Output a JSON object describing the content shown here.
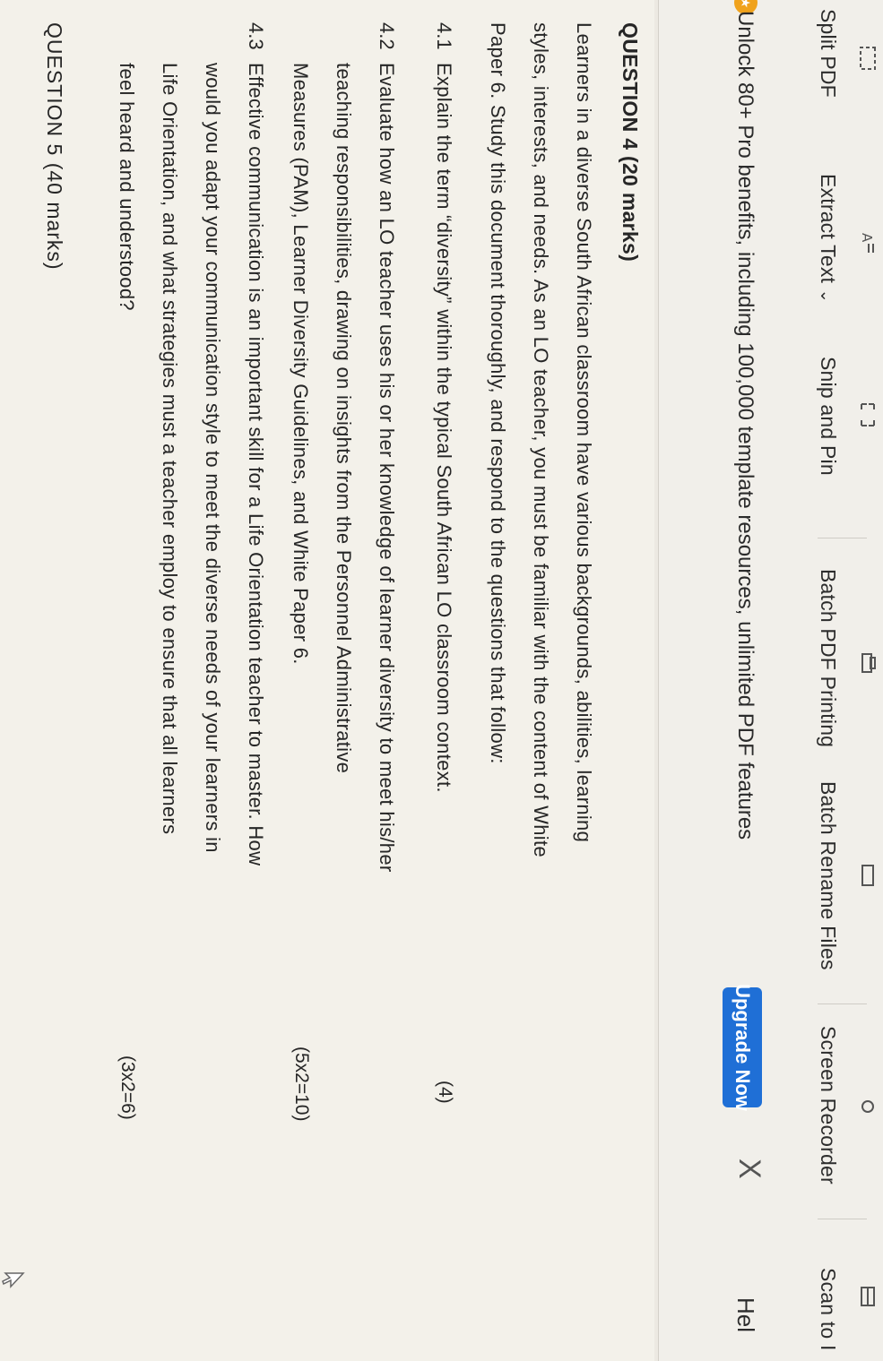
{
  "toolbar": {
    "items": [
      {
        "label": "Split PDF",
        "icon": "split-pdf-icon"
      },
      {
        "label": "Extract Text",
        "icon": "extract-text-icon"
      },
      {
        "label": "Snip and Pin",
        "icon": "snip-pin-icon"
      },
      {
        "label": "Batch PDF Printing",
        "icon": "batch-print-icon"
      },
      {
        "label": "Batch Rename Files",
        "icon": "batch-rename-icon"
      },
      {
        "label": "Screen Recorder",
        "icon": "screen-recorder-icon"
      },
      {
        "label": "Scan to I",
        "icon": "scan-icon"
      }
    ],
    "extract_dropdown": "⌄"
  },
  "banner": {
    "text": "Unlock 80+ Pro benefits, including 100,000 template resources, unlimited PDF features",
    "upgrade_label": "Upgrade Now",
    "close_glyph": "X",
    "help_label": "Hel"
  },
  "document": {
    "q4_heading": "QUESTION 4 (20 marks)",
    "intro_lines": [
      "Learners in a diverse South African classroom have various backgrounds, abilities, learning",
      "styles, interests, and needs. As an LO teacher, you must be familiar with the content of White",
      "Paper 6. Study this document thoroughly, and respond to the questions that follow:"
    ],
    "q41": {
      "number": "4.1",
      "text": "Explain the term “diversity” within the typical South African LO classroom context.",
      "marks": "(4)"
    },
    "q42": {
      "number": "4.2",
      "lines": [
        "Evaluate how an LO teacher uses his or her knowledge of learner diversity to meet his/her",
        "teaching   responsibilities,   drawing   on   insights   from   the   Personnel   Administrative",
        "Measures (PAM), Learner Diversity Guidelines, and White Paper 6."
      ],
      "marks": "(5x2=10)"
    },
    "q43": {
      "number": "4.3",
      "lines": [
        "Effective communication is an important skill for a Life Orientation teacher to master. How",
        "would you adapt your communication style to meet the diverse needs of your learners in",
        "Life Orientation, and what strategies must a teacher employ to ensure that all learners",
        "feel heard and understood?"
      ],
      "marks": "(3x2=6)"
    },
    "q5_heading": "QUESTION 5 (40 marks)"
  }
}
